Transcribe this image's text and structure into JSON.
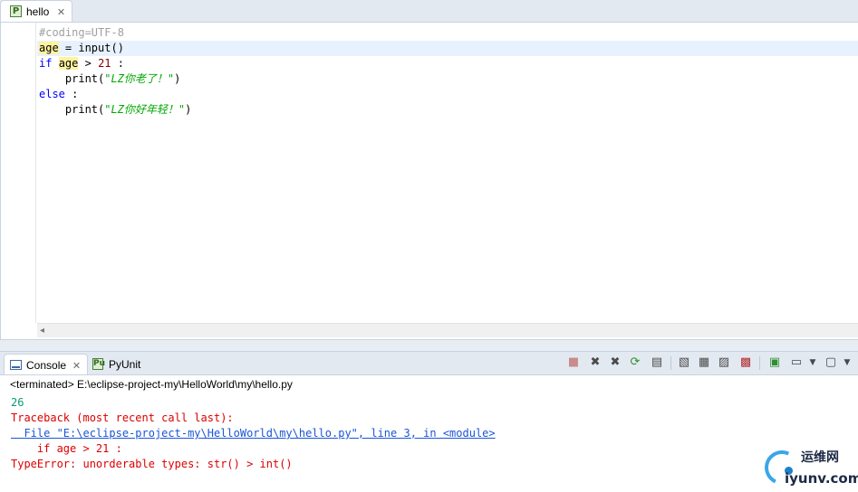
{
  "editor": {
    "tab_label": "hello",
    "lines": [
      {
        "tokens": [
          {
            "t": "#coding=UTF-8",
            "c": "comment"
          }
        ]
      },
      {
        "current": true,
        "tokens": [
          {
            "t": "age",
            "c": "hl"
          },
          {
            "t": " = input()",
            "c": "fn"
          }
        ]
      },
      {
        "tokens": [
          {
            "t": "if",
            "c": "kw"
          },
          {
            "t": " ",
            "c": "fn"
          },
          {
            "t": "age",
            "c": "hl"
          },
          {
            "t": " > ",
            "c": "fn"
          },
          {
            "t": "21",
            "c": "num"
          },
          {
            "t": " :",
            "c": "fn"
          }
        ]
      },
      {
        "tokens": [
          {
            "t": "    print(",
            "c": "fn"
          },
          {
            "t": "\"LZ你老了！\"",
            "c": "str"
          },
          {
            "t": ")",
            "c": "fn"
          }
        ]
      },
      {
        "tokens": [
          {
            "t": "else",
            "c": "kw"
          },
          {
            "t": " :",
            "c": "fn"
          }
        ]
      },
      {
        "tokens": [
          {
            "t": "    print(",
            "c": "fn"
          },
          {
            "t": "\"LZ你好年轻！\"",
            "c": "str"
          },
          {
            "t": ")",
            "c": "fn"
          }
        ]
      }
    ]
  },
  "console": {
    "tab_label": "Console",
    "pyunit_label": "PyUnit",
    "terminated": "<terminated> E:\\eclipse-project-my\\HelloWorld\\my\\hello.py",
    "output": [
      {
        "text": "26",
        "kind": "stdout"
      },
      {
        "text": "Traceback (most recent call last):",
        "kind": "stderr"
      },
      {
        "text": "  File \"E:\\eclipse-project-my\\HelloWorld\\my\\hello.py\", line 3, in <module>",
        "kind": "link"
      },
      {
        "text": "    if age > 21 :",
        "kind": "stderr"
      },
      {
        "text": "TypeError: unorderable types: str() > int()",
        "kind": "stderr"
      }
    ]
  },
  "watermark": {
    "cn": "运维网",
    "en": "iyunv.com"
  },
  "colors": {
    "stdout": "#0a9a72",
    "stderr": "#dd0000",
    "link": "#1a55d8",
    "keyword": "#0000ff",
    "string": "#00aa00"
  },
  "icons": [
    "python-file-icon",
    "close-icon",
    "console-icon",
    "pyunit-icon",
    "terminate-icon",
    "remove-launch-icon",
    "remove-all-icon",
    "relaunch-icon",
    "clear-console-icon",
    "scroll-lock-icon",
    "word-wrap-icon",
    "pin-console-icon",
    "open-console-icon"
  ]
}
